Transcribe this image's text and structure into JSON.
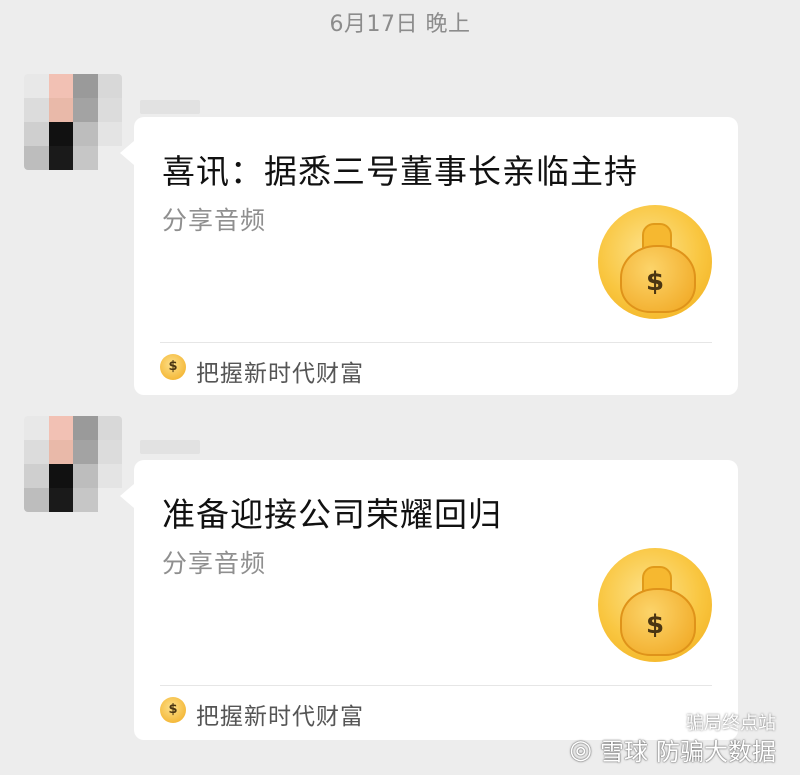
{
  "chat": {
    "timestamp": "6月17日 晚上",
    "messages": [
      {
        "title": "喜讯：据悉三号董事长亲临主持",
        "subtitle": "分享音频",
        "cover_icon": "money-bag-icon",
        "cover_symbol": "$",
        "source_label": "把握新时代财富",
        "source_icon_symbol": "$"
      },
      {
        "title": "准备迎接公司荣耀回归",
        "subtitle": "分享音频",
        "cover_icon": "money-bag-icon",
        "cover_symbol": "$",
        "source_label": "把握新时代财富",
        "source_icon_symbol": "$"
      }
    ]
  },
  "watermark": {
    "logo": "◎",
    "platform": "雪球",
    "channel": "防骗大数据",
    "wechat_channel": "骗局终点站"
  },
  "colors": {
    "background": "#ededed",
    "card": "#ffffff",
    "gold": "#f7c040"
  }
}
